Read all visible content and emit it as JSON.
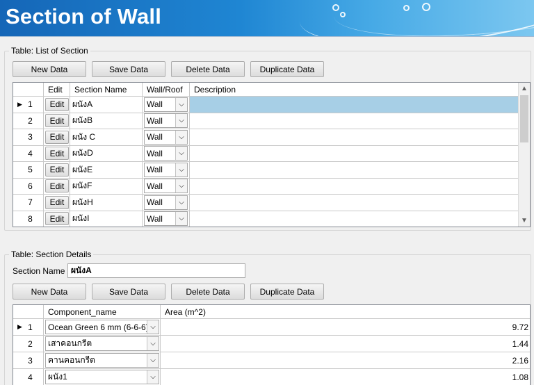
{
  "header": {
    "title": "Section of Wall"
  },
  "section_list": {
    "legend": "Table: List of Section",
    "buttons": {
      "new": "New Data",
      "save": "Save Data",
      "delete": "Delete Data",
      "duplicate": "Duplicate Data"
    },
    "columns": {
      "edit": "Edit",
      "name": "Section Name",
      "type": "Wall/Roof",
      "description": "Description"
    },
    "edit_label": "Edit",
    "rows": [
      {
        "no": "1",
        "name": "ผนังA",
        "type": "Wall",
        "description": ""
      },
      {
        "no": "2",
        "name": "ผนังB",
        "type": "Wall",
        "description": ""
      },
      {
        "no": "3",
        "name": "ผนัง C",
        "type": "Wall",
        "description": ""
      },
      {
        "no": "4",
        "name": "ผนังD",
        "type": "Wall",
        "description": ""
      },
      {
        "no": "5",
        "name": "ผนังE",
        "type": "Wall",
        "description": ""
      },
      {
        "no": "6",
        "name": "ผนังF",
        "type": "Wall",
        "description": ""
      },
      {
        "no": "7",
        "name": "ผนังH",
        "type": "Wall",
        "description": ""
      },
      {
        "no": "8",
        "name": "ผนังI",
        "type": "Wall",
        "description": ""
      }
    ]
  },
  "section_details": {
    "legend": "Table: Section Details",
    "section_name_label": "Section Name",
    "section_name_value": "ผนังA",
    "buttons": {
      "new": "New Data",
      "save": "Save Data",
      "delete": "Delete Data",
      "duplicate": "Duplicate Data"
    },
    "columns": {
      "component": "Component_name",
      "area": "Area (m^2)"
    },
    "rows": [
      {
        "no": "1",
        "component": "Ocean Green 6 mm (6-6-6)",
        "area": "9.72"
      },
      {
        "no": "2",
        "component": "เสาคอนกรีต",
        "area": "1.44"
      },
      {
        "no": "3",
        "component": "คานคอนกรีต",
        "area": "2.16"
      },
      {
        "no": "4",
        "component": "ผนัง1",
        "area": "1.08"
      }
    ]
  },
  "colors": {
    "header_blue": "#1f86d3",
    "selection": "#a7cfe6"
  }
}
